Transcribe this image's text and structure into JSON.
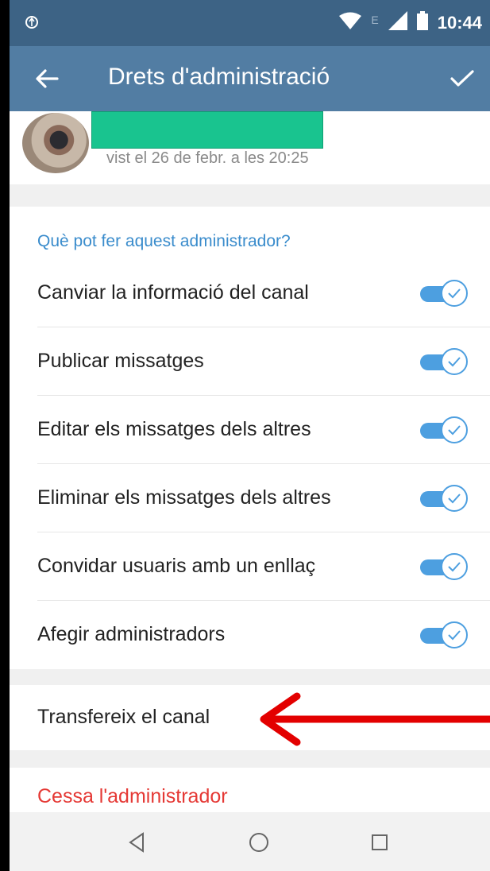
{
  "status_bar": {
    "time": "10:44",
    "network_letter": "E"
  },
  "app_bar": {
    "title": "Drets d'administració"
  },
  "user": {
    "last_seen": "vist el 26 de febr. a les 20:25"
  },
  "section": {
    "header": "Què pot fer aquest administrador?"
  },
  "permissions": [
    {
      "label": "Canviar la informació del canal",
      "enabled": true
    },
    {
      "label": "Publicar missatges",
      "enabled": true
    },
    {
      "label": "Editar els missatges dels altres",
      "enabled": true
    },
    {
      "label": "Eliminar els missatges dels altres",
      "enabled": true
    },
    {
      "label": "Convidar usuaris amb un enllaç",
      "enabled": true
    },
    {
      "label": "Afegir administradors",
      "enabled": true
    }
  ],
  "actions": {
    "transfer_label": "Transfereix el canal",
    "dismiss_label": "Cessa l'administrador"
  },
  "colors": {
    "status_bar": "#3d6385",
    "app_bar": "#527da3",
    "accent": "#3a8ccc",
    "toggle": "#4d9fe0",
    "danger": "#e53935",
    "arrow": "#e30000"
  }
}
